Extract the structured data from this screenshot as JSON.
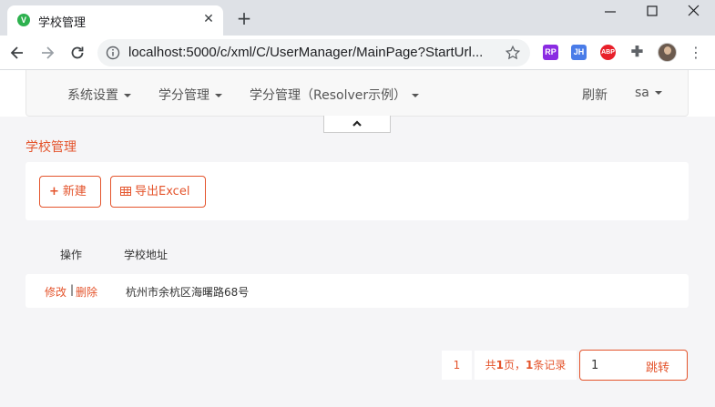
{
  "browser": {
    "tab_title": "学校管理",
    "favicon_letter": "V",
    "url": "localhost:5000/c/xml/C/UserManager/MainPage?StartUrl...",
    "extensions": {
      "rp": "RP",
      "jh": "JH",
      "abp": "ABP"
    }
  },
  "navbar": {
    "items": [
      {
        "label": "系统设置"
      },
      {
        "label": "学分管理"
      },
      {
        "label": "学分管理（Resolver示例）"
      }
    ],
    "refresh": "刷新",
    "user": "sa"
  },
  "page": {
    "title": "学校管理",
    "buttons": {
      "new": "新建",
      "export": "导出Excel"
    },
    "table": {
      "headers": [
        "操作",
        "学校地址"
      ],
      "rows": [
        {
          "edit": "修改",
          "sep": "|",
          "delete": "删除",
          "address": "杭州市余杭区海曙路68号"
        }
      ]
    },
    "pager": {
      "page": "1",
      "total_prefix": "共",
      "total_pages": "1",
      "total_mid": "页，",
      "total_records": "1",
      "total_suffix": "条记录",
      "jump_value": "1",
      "jump_label": "跳转"
    }
  },
  "colors": {
    "accent": "#e4542c",
    "favicon": "#2db14e"
  }
}
